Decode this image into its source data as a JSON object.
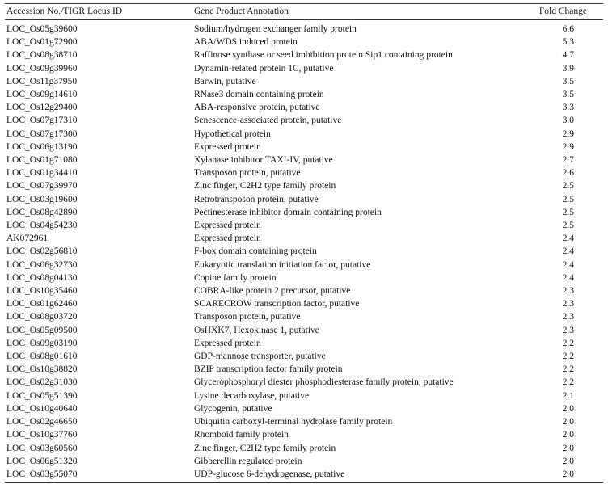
{
  "table": {
    "headers": {
      "accession": "Accession No./TIGR Locus ID",
      "annotation": "Gene Product Annotation",
      "fold": "Fold Change"
    },
    "rows": [
      {
        "id": "LOC_Os05g39600",
        "annotation": "Sodium/hydrogen exchanger family protein",
        "fold": "6.6"
      },
      {
        "id": "LOC_Os01g72900",
        "annotation": "ABA/WDS induced protein",
        "fold": "5.3"
      },
      {
        "id": "LOC_Os08g38710",
        "annotation": "Raffinose synthase or seed imbibition protein Sip1 containing protein",
        "fold": "4.7"
      },
      {
        "id": "LOC_Os09g39960",
        "annotation": "Dynamin-related protein 1C, putative",
        "fold": "3.9"
      },
      {
        "id": "LOC_Os11g37950",
        "annotation": "Barwin, putative",
        "fold": "3.5"
      },
      {
        "id": "LOC_Os09g14610",
        "annotation": "RNase3 domain containing protein",
        "fold": "3.5"
      },
      {
        "id": "LOC_Os12g29400",
        "annotation": "ABA-responsive protein, putative",
        "fold": "3.3"
      },
      {
        "id": "LOC_Os07g17310",
        "annotation": "Senescence-associated protein, putative",
        "fold": "3.0"
      },
      {
        "id": "LOC_Os07g17300",
        "annotation": "Hypothetical protein",
        "fold": "2.9"
      },
      {
        "id": "LOC_Os06g13190",
        "annotation": "Expressed protein",
        "fold": "2.9"
      },
      {
        "id": "LOC_Os01g71080",
        "annotation": "Xylanase inhibitor TAXI-IV, putative",
        "fold": "2.7"
      },
      {
        "id": "LOC_Os01g34410",
        "annotation": "Transposon protein, putative",
        "fold": "2.6"
      },
      {
        "id": "LOC_Os07g39970",
        "annotation": "Zinc finger, C2H2 type family protein",
        "fold": "2.5"
      },
      {
        "id": "LOC_Os03g19600",
        "annotation": "Retrotransposon protein, putative",
        "fold": "2.5"
      },
      {
        "id": "LOC_Os08g42890",
        "annotation": "Pectinesterase inhibitor domain containing protein",
        "fold": "2.5"
      },
      {
        "id": "LOC_Os04g54230",
        "annotation": "Expressed protein",
        "fold": "2.5"
      },
      {
        "id": "AK072961",
        "annotation": "Expressed protein",
        "fold": "2.4"
      },
      {
        "id": "LOC_Os02g56810",
        "annotation": "F-box domain containing protein",
        "fold": "2.4"
      },
      {
        "id": "LOC_Os06g32730",
        "annotation": "Eukaryotic translation initiation factor, putative",
        "fold": "2.4"
      },
      {
        "id": "LOC_Os08g04130",
        "annotation": "Copine family protein",
        "fold": "2.4"
      },
      {
        "id": "LOC_Os10g35460",
        "annotation": "COBRA-like protein 2 precursor, putative",
        "fold": "2.3"
      },
      {
        "id": "LOC_Os01g62460",
        "annotation": "SCARECROW transcription factor, putative",
        "fold": "2.3"
      },
      {
        "id": "LOC_Os08g03720",
        "annotation": "Transposon protein, putative",
        "fold": "2.3"
      },
      {
        "id": "LOC_Os05g09500",
        "annotation": "OsHXK7, Hexokinase 1, putative",
        "fold": "2.3"
      },
      {
        "id": "LOC_Os09g03190",
        "annotation": "Expressed protein",
        "fold": "2.2"
      },
      {
        "id": "LOC_Os08g01610",
        "annotation": "GDP-mannose transporter, putative",
        "fold": "2.2"
      },
      {
        "id": "LOC_Os10g38820",
        "annotation": "BZIP transcription factor family protein",
        "fold": "2.2"
      },
      {
        "id": "LOC_Os02g31030",
        "annotation": "Glycerophosphoryl diester phosphodiesterase family protein, putative",
        "fold": "2.2"
      },
      {
        "id": "LOC_Os05g51390",
        "annotation": "Lysine decarboxylase, putative",
        "fold": "2.1"
      },
      {
        "id": "LOC_Os10g40640",
        "annotation": "Glycogenin, putative",
        "fold": "2.0"
      },
      {
        "id": "LOC_Os02g46650",
        "annotation": "Ubiquitin carboxyl-terminal hydrolase family protein",
        "fold": "2.0"
      },
      {
        "id": "LOC_Os10g37760",
        "annotation": "Rhomboid family protein",
        "fold": "2.0"
      },
      {
        "id": "LOC_Os03g60560",
        "annotation": "Zinc finger, C2H2 type family protein",
        "fold": "2.0"
      },
      {
        "id": "LOC_Os06g51320",
        "annotation": "Gibberellin regulated protein",
        "fold": "2.0"
      },
      {
        "id": "LOC_Os03g55070",
        "annotation": "UDP-glucose 6-dehydrogenase, putative",
        "fold": "2.0"
      }
    ]
  }
}
